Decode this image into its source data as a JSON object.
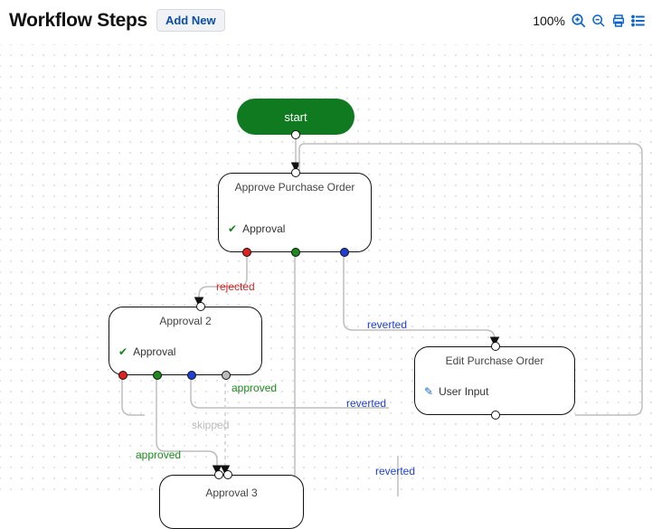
{
  "header": {
    "title": "Workflow Steps",
    "add_label": "Add New",
    "zoom_pct": "100%"
  },
  "icons": {
    "zoom_in": "zoom-in-icon",
    "zoom_out": "zoom-out-icon",
    "print": "print-icon",
    "list": "list-icon"
  },
  "nodes": {
    "start": {
      "label": "start"
    },
    "approve_po": {
      "title": "Approve Purchase Order",
      "sub": "Approval"
    },
    "approval2": {
      "title": "Approval 2",
      "sub": "Approval"
    },
    "approval3": {
      "title": "Approval 3"
    },
    "edit_po": {
      "title": "Edit Purchase Order",
      "sub": "User Input"
    }
  },
  "edge_labels": {
    "rejected": "rejected",
    "approved1": "approved",
    "approved2": "approved",
    "skipped": "skipped",
    "reverted1": "reverted",
    "reverted2": "reverted",
    "reverted3": "reverted"
  }
}
